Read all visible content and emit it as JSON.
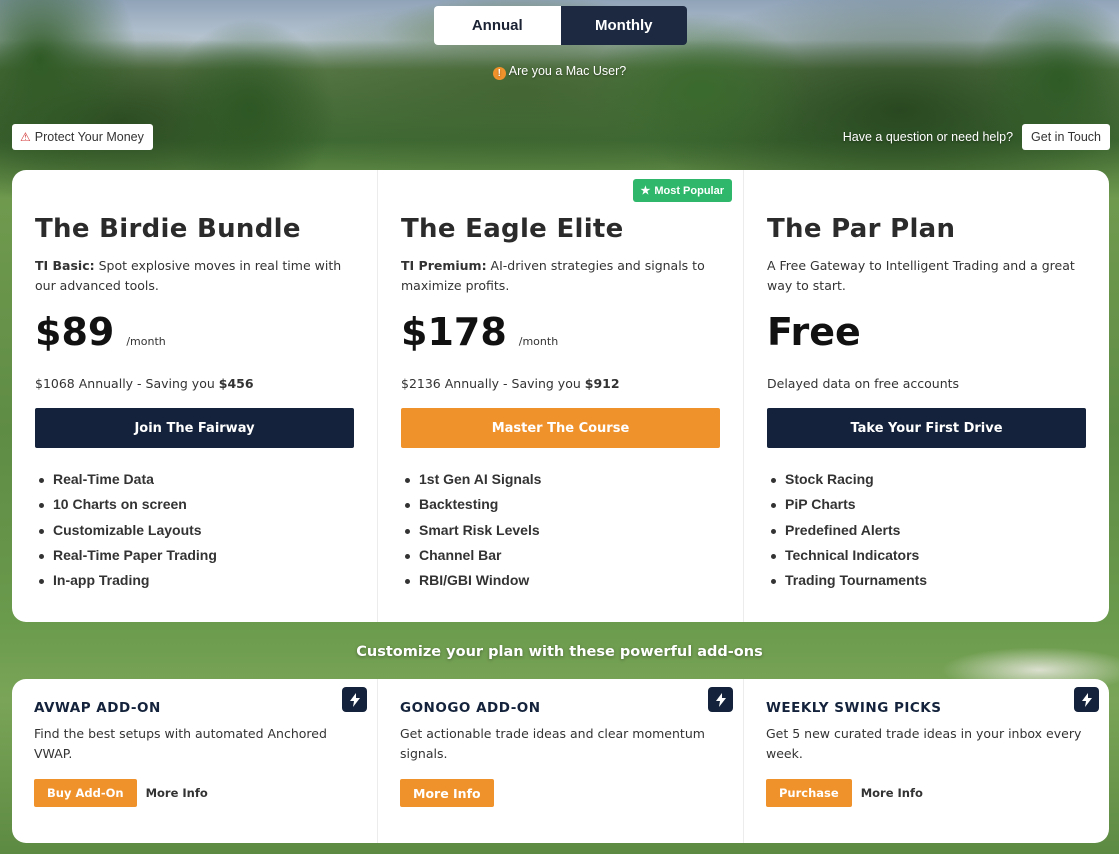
{
  "toggle": {
    "annual": "Annual",
    "monthly": "Monthly"
  },
  "mac_note": {
    "icon": "exclamation-icon",
    "text": "Are you a Mac User?"
  },
  "protect": {
    "icon": "warning-icon",
    "label": "Protect Your Money"
  },
  "help": {
    "question": "Have a question or need help?",
    "button": "Get in Touch"
  },
  "plans": [
    {
      "title": "The Birdie Bundle",
      "desc_bold": "TI Basic:",
      "desc": " Spot explosive moves in real time with our advanced tools.",
      "price": "$89",
      "per": "/month",
      "annual_text": "$1068 Annually - Saving you ",
      "annual_saving": "$456",
      "cta": "Join The Fairway",
      "features": [
        "Real-Time Data",
        "10 Charts on screen",
        "Customizable Layouts",
        "Real-Time Paper Trading",
        "In-app Trading"
      ]
    },
    {
      "title": "The Eagle Elite",
      "badge": "Most Popular",
      "desc_bold": "TI Premium:",
      "desc": " AI-driven strategies and signals to maximize profits.",
      "price": "$178",
      "per": "/month",
      "annual_text": "$2136 Annually - Saving you ",
      "annual_saving": "$912",
      "cta": "Master The Course",
      "features": [
        "1st Gen AI Signals",
        "Backtesting",
        "Smart Risk Levels",
        "Channel Bar",
        "RBI/GBI Window"
      ]
    },
    {
      "title": "The Par Plan",
      "desc": "A Free Gateway to Intelligent Trading and a great way to start.",
      "price": "Free",
      "note": "Delayed data on free accounts",
      "cta": "Take Your First Drive",
      "features": [
        "Stock Racing",
        "PiP Charts",
        "Predefined Alerts",
        "Technical Indicators",
        "Trading Tournaments"
      ]
    }
  ],
  "addons_heading": "Customize your plan with these powerful add-ons",
  "addons": [
    {
      "title": "AVWAP ADD-ON",
      "desc": "Find the best setups with automated Anchored VWAP.",
      "primary": "Buy Add-On",
      "secondary": "More Info"
    },
    {
      "title": "GONOGO ADD-ON",
      "desc": "Get actionable trade ideas and clear momentum signals.",
      "primary": "More Info"
    },
    {
      "title": "WEEKLY SWING PICKS",
      "desc": "Get 5 new curated trade ideas in your inbox every week.",
      "primary": "Purchase",
      "secondary": "More Info"
    }
  ],
  "colors": {
    "navy": "#14233b",
    "orange": "#f0922c",
    "green": "#2fb86b"
  }
}
